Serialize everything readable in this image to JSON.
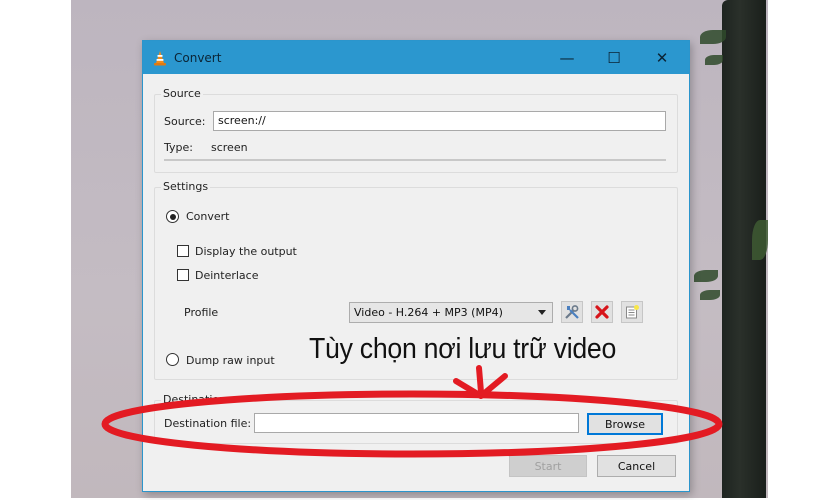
{
  "window": {
    "title": "Convert",
    "controls": {
      "minimize": "—",
      "maximize": "☐",
      "close": "✕"
    }
  },
  "source": {
    "group_label": "Source",
    "source_label": "Source:",
    "source_value": "screen://",
    "type_label": "Type:",
    "type_value": "screen"
  },
  "settings": {
    "group_label": "Settings",
    "convert_label": "Convert",
    "convert_selected": true,
    "display_output_label": "Display the output",
    "display_output_checked": false,
    "deinterlace_label": "Deinterlace",
    "deinterlace_checked": false,
    "profile_label": "Profile",
    "profile_value": "Video - H.264 + MP3 (MP4)",
    "dump_raw_label": "Dump raw input",
    "dump_raw_selected": false
  },
  "destination": {
    "group_label": "Destination",
    "file_label": "Destination file:",
    "file_value": "",
    "browse_label": "Browse"
  },
  "footer": {
    "start_label": "Start",
    "cancel_label": "Cancel"
  },
  "annotation": {
    "text": "Tùy chọn nơi lưu trữ video",
    "color": "#e31b23"
  }
}
